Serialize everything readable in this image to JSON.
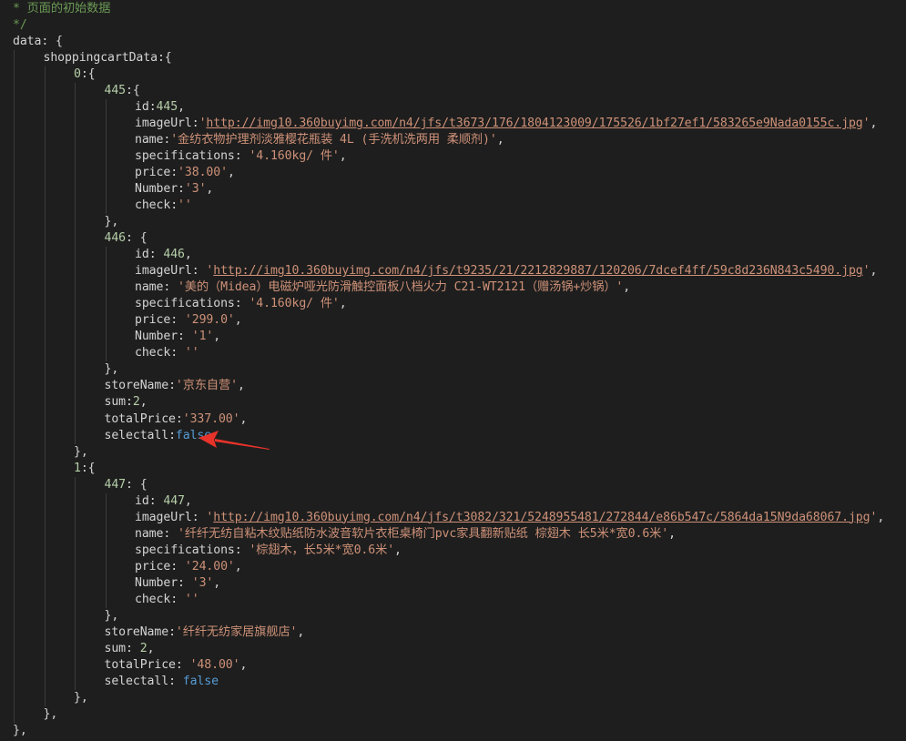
{
  "editor": {
    "lines": [
      {
        "indent": 0,
        "segs": [
          [
            "c",
            "* 页面的初始数据"
          ]
        ]
      },
      {
        "indent": 0,
        "segs": [
          [
            "c",
            "*/"
          ]
        ]
      },
      {
        "indent": 0,
        "segs": [
          [
            "k",
            "data"
          ],
          [
            "p",
            ": {"
          ]
        ]
      },
      {
        "indent": 1,
        "segs": [
          [
            "k",
            "shoppingcartData"
          ],
          [
            "p",
            ":{"
          ]
        ]
      },
      {
        "indent": 2,
        "segs": [
          [
            "n",
            "0"
          ],
          [
            "p",
            ":{"
          ]
        ]
      },
      {
        "indent": 3,
        "segs": [
          [
            "n",
            "445"
          ],
          [
            "p",
            ":{"
          ]
        ]
      },
      {
        "indent": 4,
        "segs": [
          [
            "k",
            "id"
          ],
          [
            "p",
            ":"
          ],
          [
            "n",
            "445"
          ],
          [
            "p",
            ","
          ]
        ]
      },
      {
        "indent": 4,
        "segs": [
          [
            "k",
            "imageUrl"
          ],
          [
            "p",
            ":"
          ],
          [
            "s",
            "'"
          ],
          [
            "u",
            "http://img10.360buyimg.com/n4/jfs/t3673/176/1804123009/175526/1bf27ef1/583265e9Nada0155c.jpg"
          ],
          [
            "s",
            "'"
          ],
          [
            "p",
            ","
          ]
        ]
      },
      {
        "indent": 4,
        "segs": [
          [
            "k",
            "name"
          ],
          [
            "p",
            ":"
          ],
          [
            "s",
            "'金纺衣物护理剂淡雅樱花瓶装 4L (手洗机洗两用 柔顺剂)'"
          ],
          [
            "p",
            ","
          ]
        ]
      },
      {
        "indent": 4,
        "segs": [
          [
            "k",
            "specifications"
          ],
          [
            "p",
            ": "
          ],
          [
            "s",
            "'4.160kg/ 件'"
          ],
          [
            "p",
            ","
          ]
        ]
      },
      {
        "indent": 4,
        "segs": [
          [
            "k",
            "price"
          ],
          [
            "p",
            ":"
          ],
          [
            "s",
            "'38.00'"
          ],
          [
            "p",
            ","
          ]
        ]
      },
      {
        "indent": 4,
        "segs": [
          [
            "k",
            "Number"
          ],
          [
            "p",
            ":"
          ],
          [
            "s",
            "'3'"
          ],
          [
            "p",
            ","
          ]
        ]
      },
      {
        "indent": 4,
        "segs": [
          [
            "k",
            "check"
          ],
          [
            "p",
            ":"
          ],
          [
            "s",
            "''"
          ]
        ]
      },
      {
        "indent": 3,
        "segs": [
          [
            "p",
            "},"
          ]
        ]
      },
      {
        "indent": 3,
        "segs": [
          [
            "n",
            "446"
          ],
          [
            "p",
            ": {"
          ]
        ]
      },
      {
        "indent": 4,
        "segs": [
          [
            "k",
            "id"
          ],
          [
            "p",
            ": "
          ],
          [
            "n",
            "446"
          ],
          [
            "p",
            ","
          ]
        ]
      },
      {
        "indent": 4,
        "segs": [
          [
            "k",
            "imageUrl"
          ],
          [
            "p",
            ": "
          ],
          [
            "s",
            "'"
          ],
          [
            "u",
            "http://img10.360buyimg.com/n4/jfs/t9235/21/2212829887/120206/7dcef4ff/59c8d236N843c5490.jpg"
          ],
          [
            "s",
            "'"
          ],
          [
            "p",
            ","
          ]
        ]
      },
      {
        "indent": 4,
        "segs": [
          [
            "k",
            "name"
          ],
          [
            "p",
            ": "
          ],
          [
            "s",
            "'美的（Midea）电磁炉哑光防滑触控面板八档火力 C21-WT2121（赠汤锅+炒锅）'"
          ],
          [
            "p",
            ","
          ]
        ]
      },
      {
        "indent": 4,
        "segs": [
          [
            "k",
            "specifications"
          ],
          [
            "p",
            ": "
          ],
          [
            "s",
            "'4.160kg/ 件'"
          ],
          [
            "p",
            ","
          ]
        ]
      },
      {
        "indent": 4,
        "segs": [
          [
            "k",
            "price"
          ],
          [
            "p",
            ": "
          ],
          [
            "s",
            "'299.0'"
          ],
          [
            "p",
            ","
          ]
        ]
      },
      {
        "indent": 4,
        "segs": [
          [
            "k",
            "Number"
          ],
          [
            "p",
            ": "
          ],
          [
            "s",
            "'1'"
          ],
          [
            "p",
            ","
          ]
        ]
      },
      {
        "indent": 4,
        "segs": [
          [
            "k",
            "check"
          ],
          [
            "p",
            ": "
          ],
          [
            "s",
            "''"
          ]
        ]
      },
      {
        "indent": 3,
        "segs": [
          [
            "p",
            "},"
          ]
        ]
      },
      {
        "indent": 3,
        "segs": [
          [
            "k",
            "storeName"
          ],
          [
            "p",
            ":"
          ],
          [
            "s",
            "'京东自营'"
          ],
          [
            "p",
            ","
          ]
        ]
      },
      {
        "indent": 3,
        "segs": [
          [
            "k",
            "sum"
          ],
          [
            "p",
            ":"
          ],
          [
            "n",
            "2"
          ],
          [
            "p",
            ","
          ]
        ]
      },
      {
        "indent": 3,
        "segs": [
          [
            "k",
            "totalPrice"
          ],
          [
            "p",
            ":"
          ],
          [
            "s",
            "'337.00'"
          ],
          [
            "p",
            ","
          ]
        ]
      },
      {
        "indent": 3,
        "segs": [
          [
            "k",
            "selectall"
          ],
          [
            "p",
            ":"
          ],
          [
            "b",
            "false"
          ]
        ]
      },
      {
        "indent": 2,
        "segs": [
          [
            "p",
            "},"
          ]
        ]
      },
      {
        "indent": 2,
        "segs": [
          [
            "n",
            "1"
          ],
          [
            "p",
            ":{"
          ]
        ]
      },
      {
        "indent": 3,
        "segs": [
          [
            "n",
            "447"
          ],
          [
            "p",
            ": {"
          ]
        ]
      },
      {
        "indent": 4,
        "segs": [
          [
            "k",
            "id"
          ],
          [
            "p",
            ": "
          ],
          [
            "n",
            "447"
          ],
          [
            "p",
            ","
          ]
        ]
      },
      {
        "indent": 4,
        "segs": [
          [
            "k",
            "imageUrl"
          ],
          [
            "p",
            ": "
          ],
          [
            "s",
            "'"
          ],
          [
            "u",
            "http://img10.360buyimg.com/n4/jfs/t3082/321/5248955481/272844/e86b547c/5864da15N9da68067.jpg"
          ],
          [
            "s",
            "'"
          ],
          [
            "p",
            ","
          ]
        ]
      },
      {
        "indent": 4,
        "segs": [
          [
            "k",
            "name"
          ],
          [
            "p",
            ": "
          ],
          [
            "s",
            "'纤纤无纺自粘木纹贴纸防水波音软片衣柜桌椅门pvc家具翻新贴纸 棕翅木 长5米*宽0.6米'"
          ],
          [
            "p",
            ","
          ]
        ]
      },
      {
        "indent": 4,
        "segs": [
          [
            "k",
            "specifications"
          ],
          [
            "p",
            ": "
          ],
          [
            "s",
            "'棕翅木，长5米*宽0.6米'"
          ],
          [
            "p",
            ","
          ]
        ]
      },
      {
        "indent": 4,
        "segs": [
          [
            "k",
            "price"
          ],
          [
            "p",
            ": "
          ],
          [
            "s",
            "'24.00'"
          ],
          [
            "p",
            ","
          ]
        ]
      },
      {
        "indent": 4,
        "segs": [
          [
            "k",
            "Number"
          ],
          [
            "p",
            ": "
          ],
          [
            "s",
            "'3'"
          ],
          [
            "p",
            ","
          ]
        ]
      },
      {
        "indent": 4,
        "segs": [
          [
            "k",
            "check"
          ],
          [
            "p",
            ": "
          ],
          [
            "s",
            "''"
          ]
        ]
      },
      {
        "indent": 3,
        "segs": [
          [
            "p",
            "},"
          ]
        ]
      },
      {
        "indent": 3,
        "segs": [
          [
            "k",
            "storeName"
          ],
          [
            "p",
            ":"
          ],
          [
            "s",
            "'纤纤无纺家居旗舰店'"
          ],
          [
            "p",
            ","
          ]
        ]
      },
      {
        "indent": 3,
        "segs": [
          [
            "k",
            "sum"
          ],
          [
            "p",
            ": "
          ],
          [
            "n",
            "2"
          ],
          [
            "p",
            ","
          ]
        ]
      },
      {
        "indent": 3,
        "segs": [
          [
            "k",
            "totalPrice"
          ],
          [
            "p",
            ": "
          ],
          [
            "s",
            "'48.00'"
          ],
          [
            "p",
            ","
          ]
        ]
      },
      {
        "indent": 3,
        "segs": [
          [
            "k",
            "selectall"
          ],
          [
            "p",
            ": "
          ],
          [
            "b",
            "false"
          ]
        ]
      },
      {
        "indent": 2,
        "segs": [
          [
            "p",
            "},"
          ]
        ]
      },
      {
        "indent": 1,
        "segs": [
          [
            "p",
            "},"
          ]
        ]
      },
      {
        "indent": 0,
        "segs": [
          [
            "p",
            "},"
          ]
        ]
      }
    ]
  },
  "annotation": {
    "arrow_color": "#e8332a",
    "points_to": "selectall:false"
  },
  "colors": {
    "background": "#1e1e1e",
    "comment": "#6a9955",
    "number": "#b5cea8",
    "string": "#ce9178",
    "boolean": "#569cd6",
    "text": "#d4d4d4"
  }
}
